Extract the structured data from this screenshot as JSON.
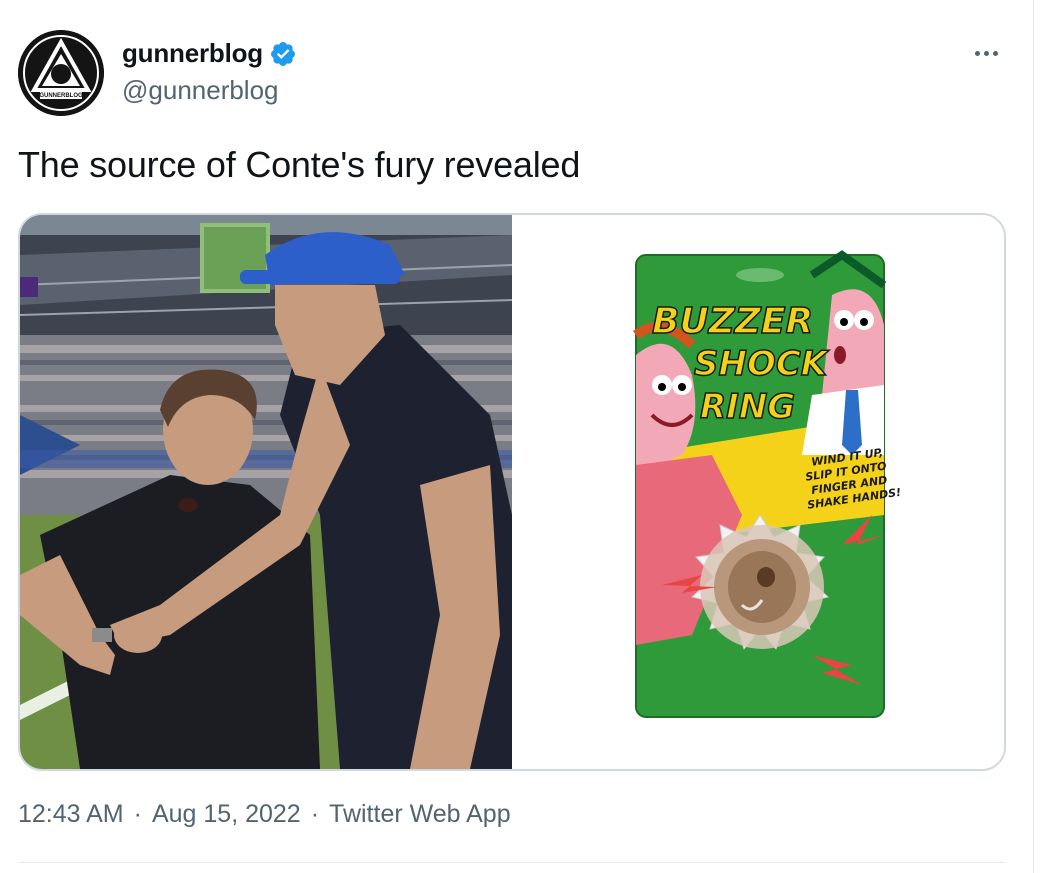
{
  "user": {
    "display_name": "gunnerblog",
    "handle": "@gunnerblog",
    "verified": true,
    "avatar_text": "GUNNERBLOG"
  },
  "tweet": {
    "text": "The source of Conte's fury revealed"
  },
  "meta": {
    "time": "12:43 AM",
    "separator": "·",
    "date": "Aug 15, 2022",
    "source": "Twitter Web App"
  },
  "product": {
    "line1": "BUZZER",
    "line2": "SHOCK",
    "line3": "RING",
    "instructions": [
      "WIND IT UP,",
      "SLIP IT ONTO",
      "FINGER AND",
      "SHAKE HANDS!"
    ]
  },
  "colors": {
    "verified_blue": "#1d9bf0",
    "package_green": "#2f9a3a",
    "package_yellow": "#f5d21a"
  },
  "icons": {
    "verified": "verified-badge-icon",
    "more": "more-dots-icon"
  }
}
